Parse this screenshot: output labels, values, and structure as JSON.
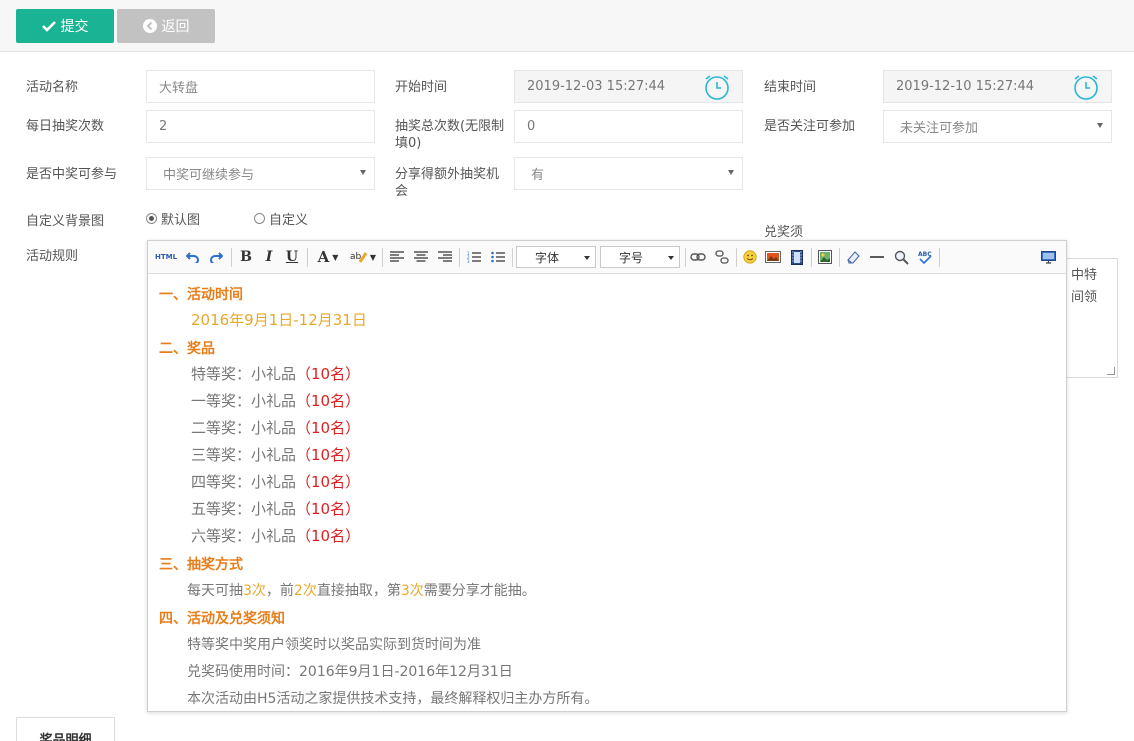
{
  "toolbar": {
    "submit_label": "提交",
    "back_label": "返回"
  },
  "form": {
    "activity_name_label": "活动名称",
    "activity_name_value": "大转盘",
    "start_time_label": "开始时间",
    "start_time_value": "2019-12-03 15:27:44",
    "end_time_label": "结束时间",
    "end_time_value": "2019-12-10 15:27:44",
    "daily_draws_label": "每日抽奖次数",
    "daily_draws_value": "2",
    "total_draws_label_line1": "抽奖总次数(无限制",
    "total_draws_label_line2": "填0)",
    "total_draws_value": "0",
    "follow_label": "是否关注可参加",
    "follow_value": "未关注可参加",
    "win_label": "是否中奖可参与",
    "win_value": "中奖可继续参与",
    "share_label_line1": "分享得额外抽奖机",
    "share_label_line2": "会",
    "share_value": "有",
    "bg_label": "自定义背景图",
    "bg_option_default": "默认图",
    "bg_option_custom": "自定义",
    "bg_selected": "默认图",
    "rules_label": "活动规则",
    "notice_label": "兑奖须",
    "notice_text_line1": "中特",
    "notice_text_line2": "间领"
  },
  "editor": {
    "toolbar": {
      "html_label": "HTML",
      "bold_label": "B",
      "italic_label": "I",
      "underline_label": "U",
      "forecolor_label": "A",
      "font_select": "字体",
      "size_select": "字号"
    },
    "content": {
      "h1": "一、活动时间",
      "date": "2016年9月1日-12月31日",
      "h2": "二、奖品",
      "prizes": [
        {
          "name": "特等奖：小礼品",
          "count": "（10名）"
        },
        {
          "name": "一等奖：小礼品",
          "count": "（10名）"
        },
        {
          "name": "二等奖：小礼品",
          "count": "（10名）"
        },
        {
          "name": "三等奖：小礼品",
          "count": "（10名）"
        },
        {
          "name": "四等奖：小礼品",
          "count": "（10名）"
        },
        {
          "name": "五等奖：小礼品",
          "count": "（10名）"
        },
        {
          "name": "六等奖：小礼品",
          "count": "（10名）"
        }
      ],
      "h3": "三、抽奖方式",
      "method": {
        "a": "每天可抽",
        "b": "3次",
        "c": "，前",
        "d": "2次",
        "e": "直接抽取，第",
        "f": "3次",
        "g": "需要分享才能抽。"
      },
      "h4": "四、活动及兑奖须知",
      "notes": [
        "特等奖中奖用户领奖时以奖品实际到货时间为准",
        "兑奖码使用时间：2016年9月1日-2016年12月31日",
        "本次活动由H5活动之家提供技术支持，最终解释权归主办方所有。"
      ]
    }
  },
  "tabs": {
    "prize_detail": "奖品明细"
  },
  "colors": {
    "accent": "#1ab394",
    "heading": "#e87e1a",
    "highlight": "#e8a92a",
    "count": "#e02020"
  }
}
